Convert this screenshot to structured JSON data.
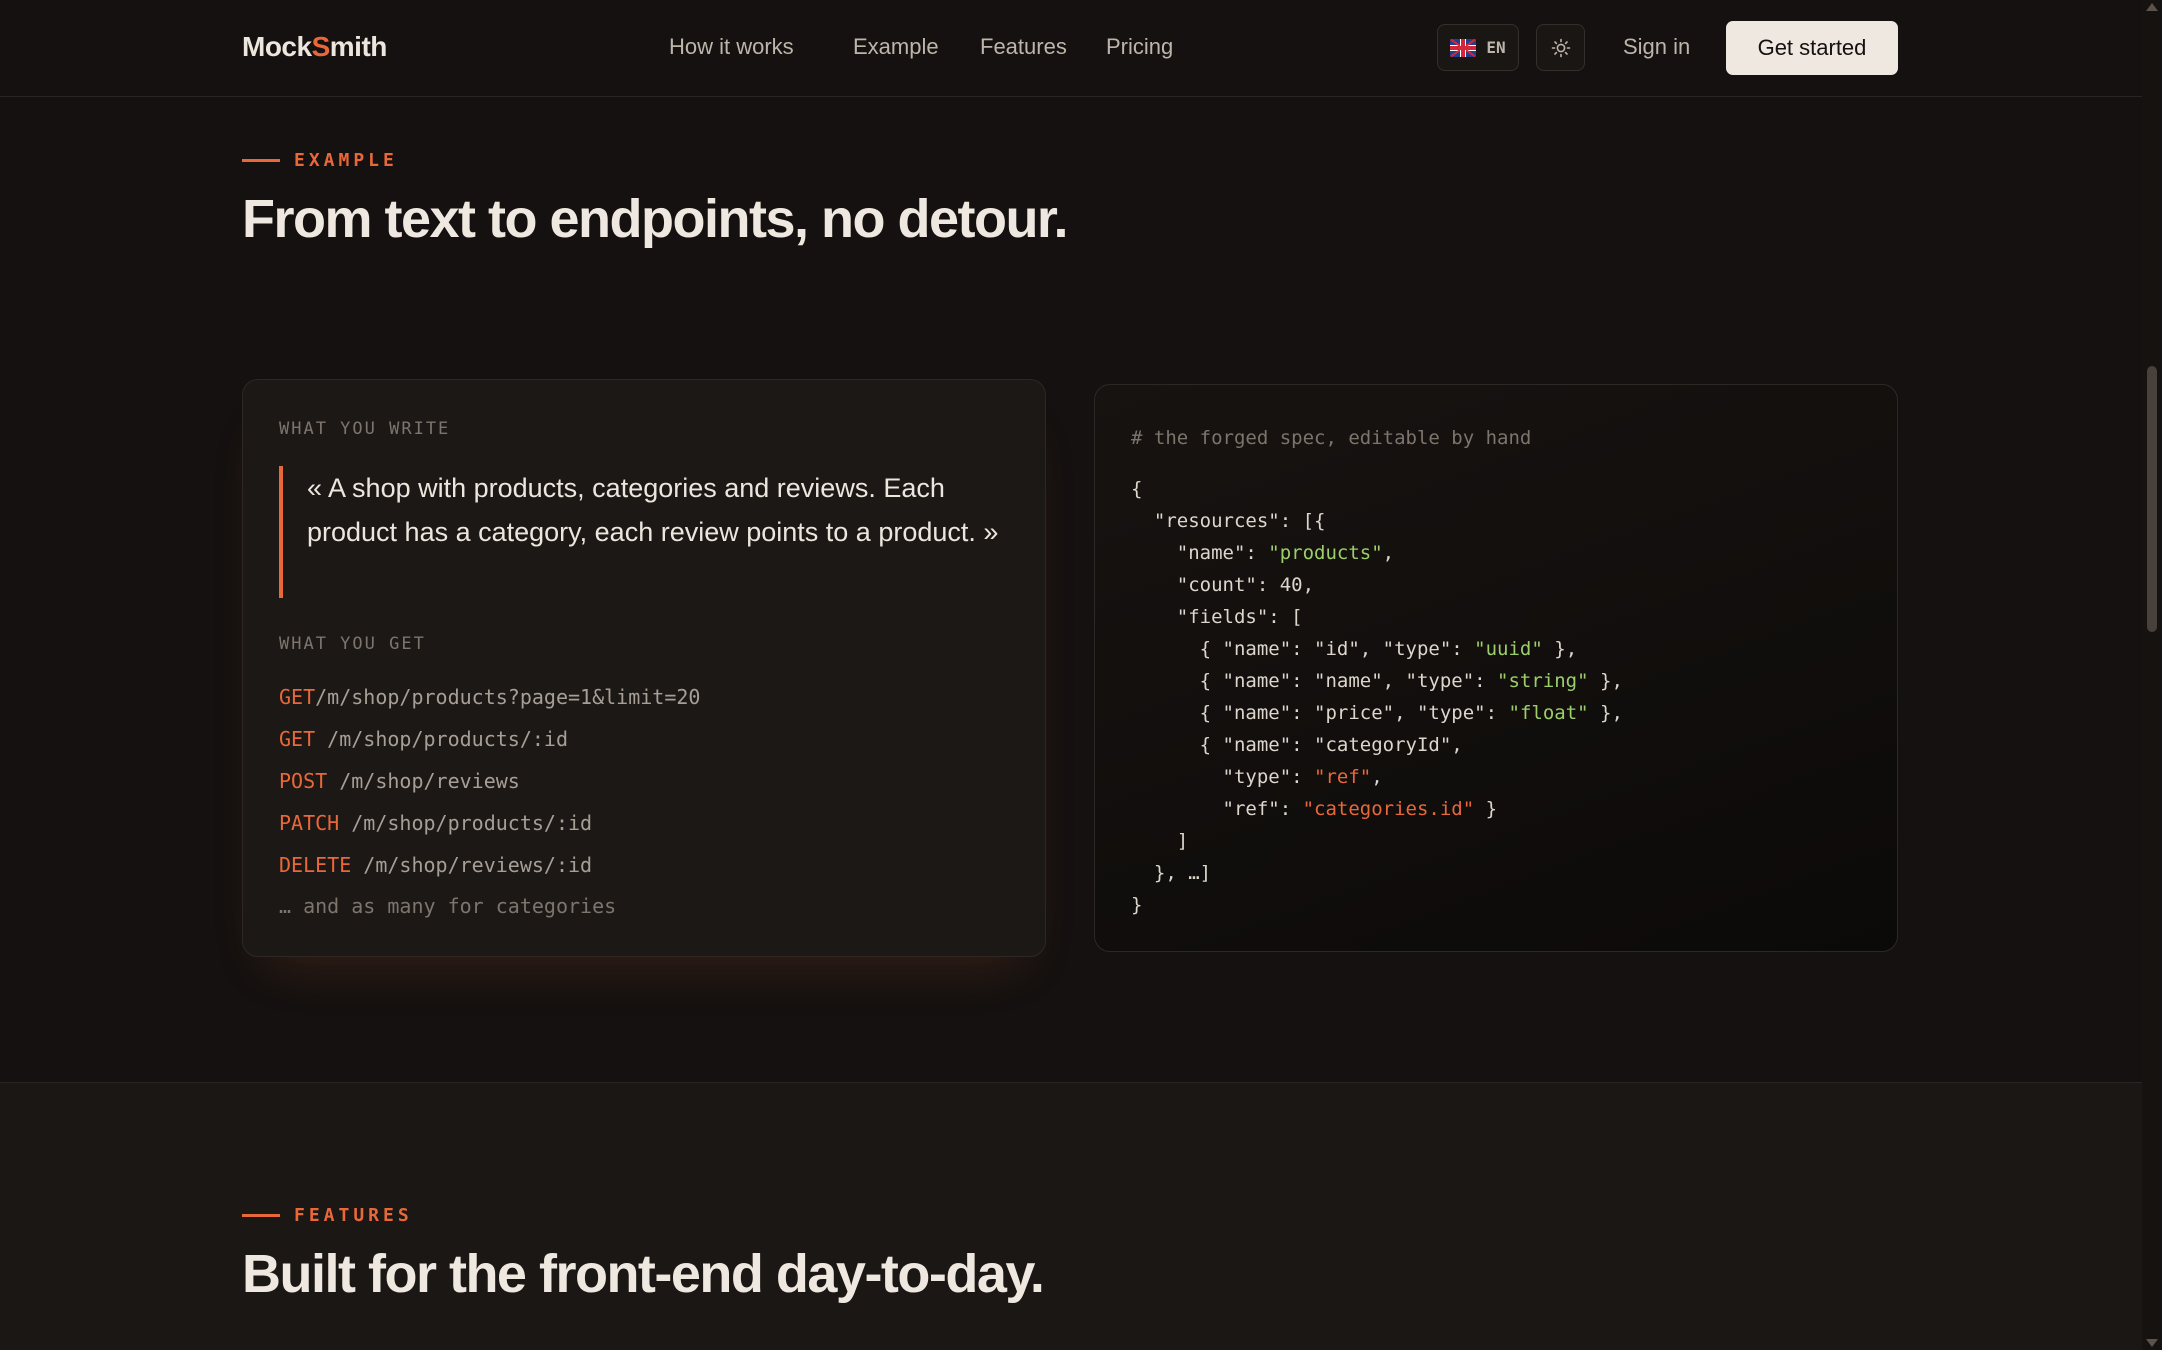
{
  "nav": {
    "logo_prefix": "Mock",
    "logo_accent": "S",
    "logo_suffix": "mith",
    "links": [
      "How it works",
      "Example",
      "Features",
      "Pricing"
    ],
    "language": "EN",
    "language_icon": "uk-flag-icon",
    "theme_icon": "sun-icon",
    "signin": "Sign in",
    "cta": "Get started"
  },
  "example": {
    "eyebrow": "EXAMPLE",
    "heading": "From text to endpoints, no detour.",
    "write_label": "WHAT YOU WRITE",
    "quote": "« A shop with products, categories and reviews. Each product has a category, each review points to a product. »",
    "get_label": "WHAT YOU GET",
    "endpoints": [
      {
        "method": "GET",
        "path": "/m/shop/products?page=1&limit=20"
      },
      {
        "method": "GET",
        "path": " /m/shop/products/:id"
      },
      {
        "method": "POST",
        "path": " /m/shop/reviews"
      },
      {
        "method": "PATCH",
        "path": " /m/shop/products/:id"
      },
      {
        "method": "DELETE",
        "path": " /m/shop/reviews/:id"
      }
    ],
    "endpoints_more": "… and as many for categories",
    "spec_comment": "# the forged spec, editable by hand",
    "spec_lines": [
      "{",
      "  \"resources\": [{",
      "    \"name\": ",
      "    \"count\": 40,",
      "    \"fields\": [",
      "      { \"name\": \"id\", \"type\": ",
      "      { \"name\": \"name\", \"type\": ",
      "      { \"name\": \"price\", \"type\": ",
      "      { \"name\": \"categoryId\",",
      "        \"type\": ",
      "        \"ref\": ",
      "    ]",
      "  }, …]",
      "}"
    ],
    "spec_strings": {
      "products": "\"products\"",
      "uuid": "\"uuid\"",
      "string": "\"string\"",
      "float": "\"float\"",
      "ref": "\"ref\"",
      "categories_id": "\"categories.id\""
    },
    "spec_tails": {
      "products": ",",
      "uuid": " },",
      "string": " },",
      "float": " },",
      "ref": ",",
      "categories_id": " }"
    }
  },
  "features": {
    "eyebrow": "FEATURES",
    "heading": "Built for the front-end day-to-day."
  },
  "colors": {
    "background": "#141110",
    "accent": "#e9683a",
    "string_green": "#9ccf6a",
    "text": "#ece6dd"
  }
}
